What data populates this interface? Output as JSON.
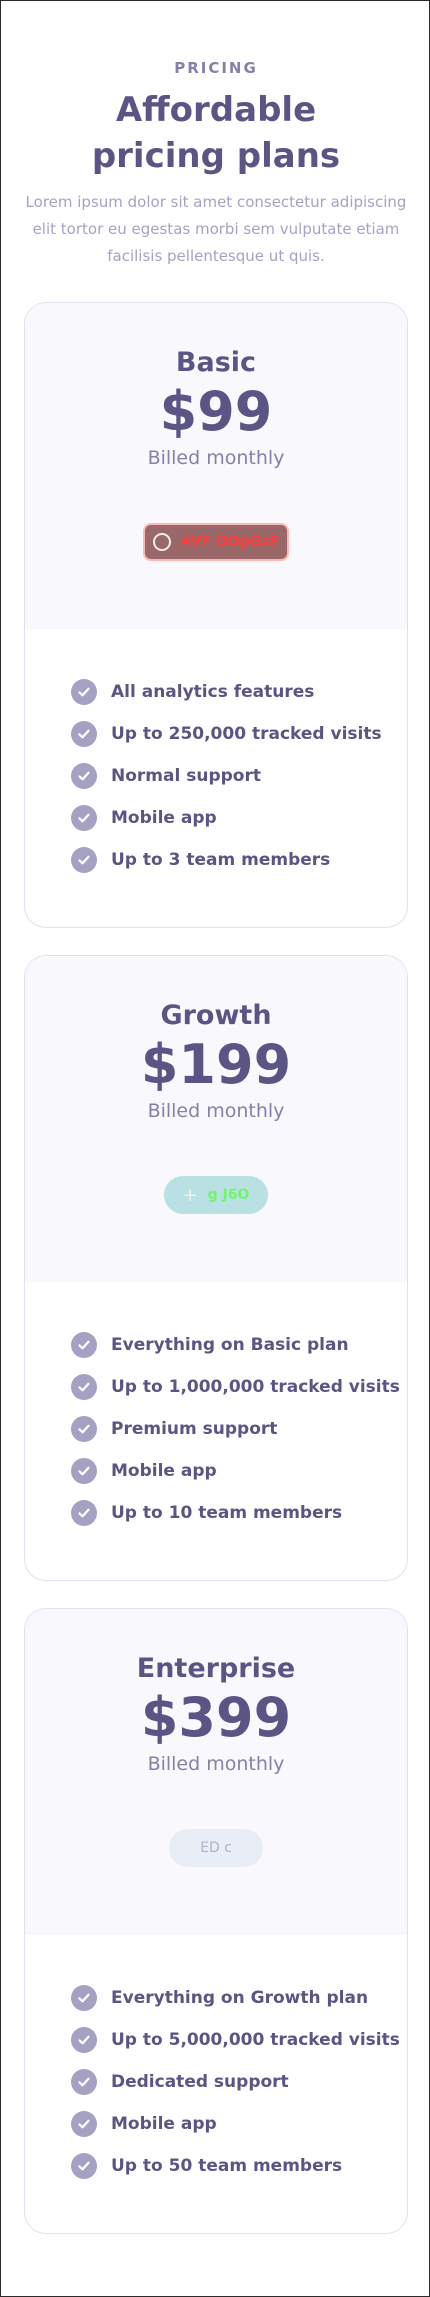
{
  "header": {
    "eyebrow": "PRICING",
    "title_line1": "Affordable",
    "title_line2": "pricing plans",
    "subtitle": "Lorem ipsum dolor sit amet consectetur adipiscing elit tortor eu egestas morbi sem vulputate etiam facilisis pellentesque ut quis."
  },
  "icons": {
    "feature_check": "check-circle-icon",
    "basic_cta": "ring-icon",
    "growth_cta": "plus-icon"
  },
  "colors": {
    "primary_text": "#5a5584",
    "muted_text": "#8580a8",
    "check_circle": "#a5a1c2",
    "card_top": "#f9f9fd"
  },
  "plans": [
    {
      "name": "Basic",
      "price": "$99",
      "billing": "Billed monthly",
      "cta_label": "4VF ODpGsF",
      "features": [
        "All analytics features",
        "Up to 250,000 tracked visits",
        "Normal support",
        "Mobile app",
        "Up to 3 team members"
      ]
    },
    {
      "name": "Growth",
      "price": "$199",
      "billing": "Billed monthly",
      "cta_label": "g J6O",
      "features": [
        "Everything on Basic plan",
        "Up to 1,000,000 tracked visits",
        "Premium support",
        "Mobile app",
        "Up to 10 team members"
      ]
    },
    {
      "name": "Enterprise",
      "price": "$399",
      "billing": "Billed monthly",
      "cta_label": "ED c",
      "features": [
        "Everything on Growth plan",
        "Up to 5,000,000 tracked visits",
        "Dedicated support",
        "Mobile app",
        "Up to 50 team members"
      ]
    }
  ]
}
